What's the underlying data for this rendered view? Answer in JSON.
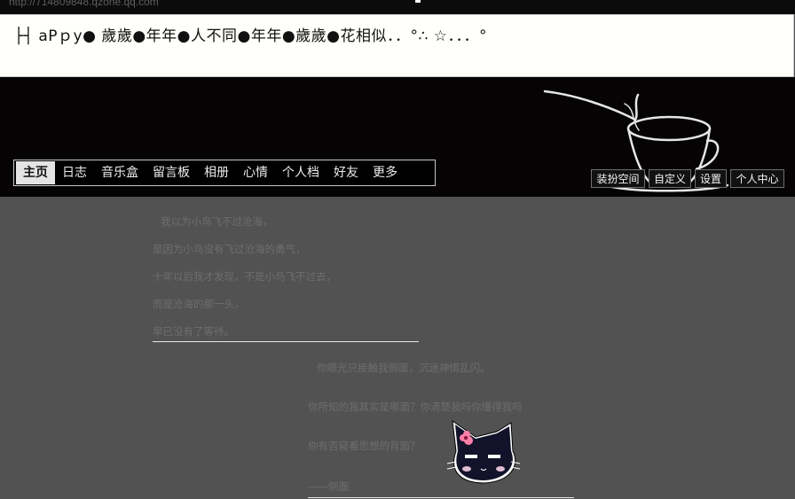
{
  "browser": {
    "url": "http://714809848.qzone.qq.com"
  },
  "header": {
    "site_title": "├┤ aPｐy● 歲歲●年年●人不同●年年●歲歲●花相似．．°∴ ☆．．．°"
  },
  "nav": {
    "items": [
      {
        "label": "主页",
        "active": true
      },
      {
        "label": "日志"
      },
      {
        "label": "音乐盒"
      },
      {
        "label": "留言板"
      },
      {
        "label": "相册"
      },
      {
        "label": "心情"
      },
      {
        "label": "个人档"
      },
      {
        "label": "好友"
      },
      {
        "label": "更多"
      }
    ]
  },
  "toolbar": {
    "decorate_label": "装扮空间",
    "customize_label": "自定义",
    "settings_label": "设置",
    "profile_center_label": "个人中心"
  },
  "content": {
    "poem1": [
      "我以为小鸟飞不过沧海，",
      "是因为小鸟没有飞过沧海的勇气，",
      "十年以后我才发现，不是小鸟飞不过去，",
      "而是沧海的那一头，",
      "早已没有了等待。"
    ],
    "poem2": [
      "你眼光只接触我侧面，沉迷神情乱闪。",
      "你所知的我其实是哪面？你清楚我吗你懂得我吗",
      "你有否窥看思想的背面？",
      "——侧面"
    ]
  },
  "colors": {
    "header_bg": "#060304",
    "content_bg": "#525252",
    "nav_active_bg": "#e4e4e4"
  }
}
